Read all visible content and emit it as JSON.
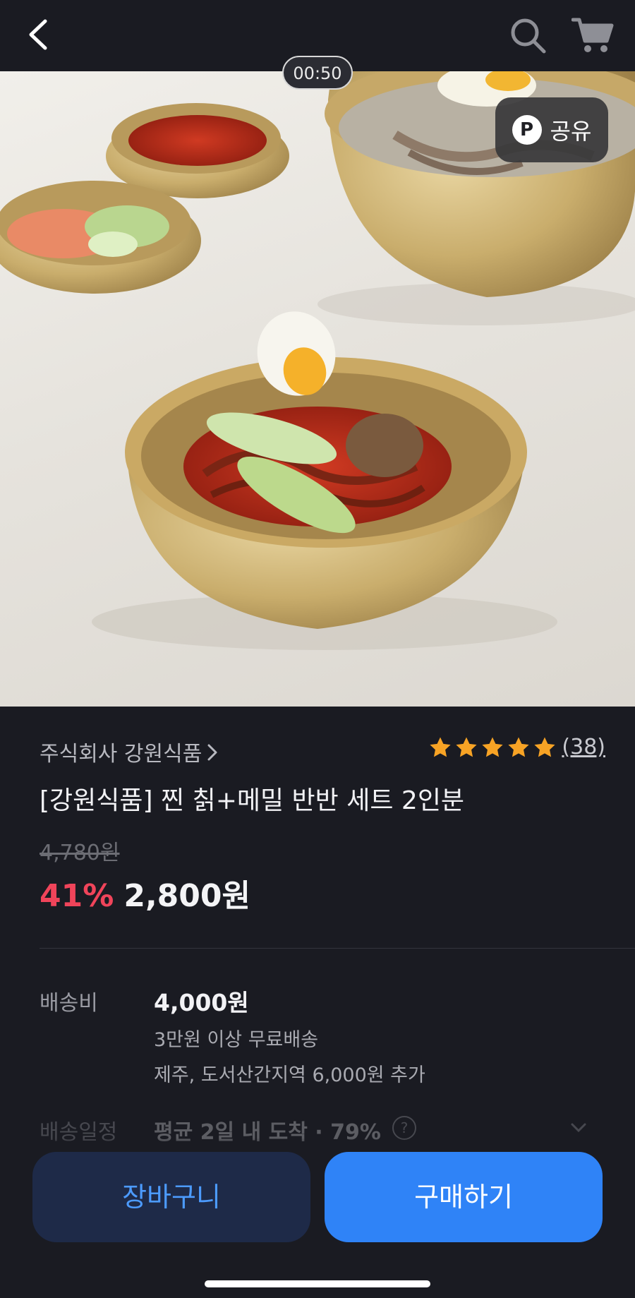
{
  "header": {
    "back_icon": "chevron-left-icon",
    "search_icon": "search-icon",
    "cart_icon": "cart-icon"
  },
  "media": {
    "timer": "00:50",
    "share_label": "공유",
    "share_icon_letter": "P"
  },
  "product": {
    "brand": "주식회사 강원식품",
    "rating_stars": 5,
    "review_count": "(38)",
    "title": "[강원식품] 찐 칡+메밀 반반 세트 2인분",
    "original_price": "4,780원",
    "discount": "41%",
    "sale_price": "2,800원"
  },
  "shipping": {
    "label": "배송비",
    "fee": "4,000원",
    "free_condition": "3만원 이상 무료배송",
    "extra_fee": "제주, 도서산간지역 6,000원 추가"
  },
  "schedule": {
    "label": "배송일정",
    "value": "평균 2일 내 도착 · 79%"
  },
  "actions": {
    "cart_button": "장바구니",
    "buy_button": "구매하기"
  },
  "colors": {
    "background": "#1a1b22",
    "discount": "#f0445a",
    "primary_button": "#2f83f7",
    "secondary_button": "#1e2a48",
    "star": "#f7a325"
  }
}
